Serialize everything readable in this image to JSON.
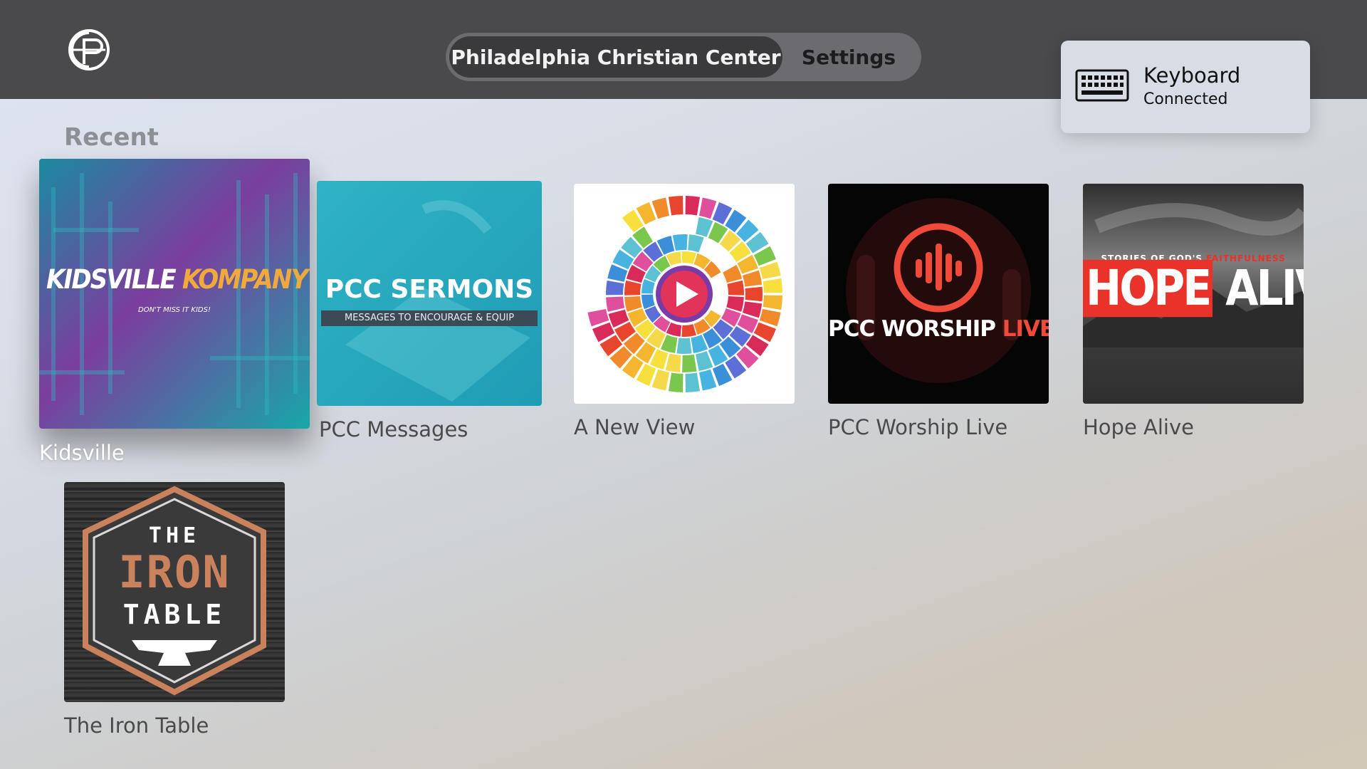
{
  "nav": {
    "tabs": [
      {
        "label": "Philadelphia Christian Center",
        "active": true
      },
      {
        "label": "Settings",
        "active": false
      }
    ]
  },
  "toast": {
    "title": "Keyboard",
    "subtitle": "Connected",
    "icon": "keyboard-icon"
  },
  "recent": {
    "title": "Recent",
    "items": [
      {
        "label": "Kidsville",
        "art_main": "KIDSVILLE",
        "art_accent": "KOMPANY LIVE",
        "art_tag": "DON'T MISS IT KIDS!",
        "focused": true
      },
      {
        "label": "PCC Messages",
        "art_main": "PCC SERMONS",
        "art_tag": "MESSAGES TO ENCOURAGE & EQUIP"
      },
      {
        "label": "A New View"
      },
      {
        "label": "PCC Worship Live",
        "art_main": "PCC WORSHIP",
        "art_accent": "LIVE"
      },
      {
        "label": "Hope Alive",
        "art_tag": "STORIES OF GOD'S",
        "art_tag_accent": "FAITHFULNESS",
        "art_main": "HOPE",
        "art_accent": "ALIVE"
      },
      {
        "label": "The Iron Table",
        "art_top": "THE",
        "art_main": "IRON",
        "art_bottom": "TABLE"
      }
    ]
  },
  "colors": {
    "topbar": "#4a4a4c",
    "tab_active": "#3a3a3c",
    "kidsville_accent": "#f2a93b",
    "worship_live": "#f04a3a",
    "hope_red": "#e8322a",
    "iron_copper": "#c9825c"
  }
}
